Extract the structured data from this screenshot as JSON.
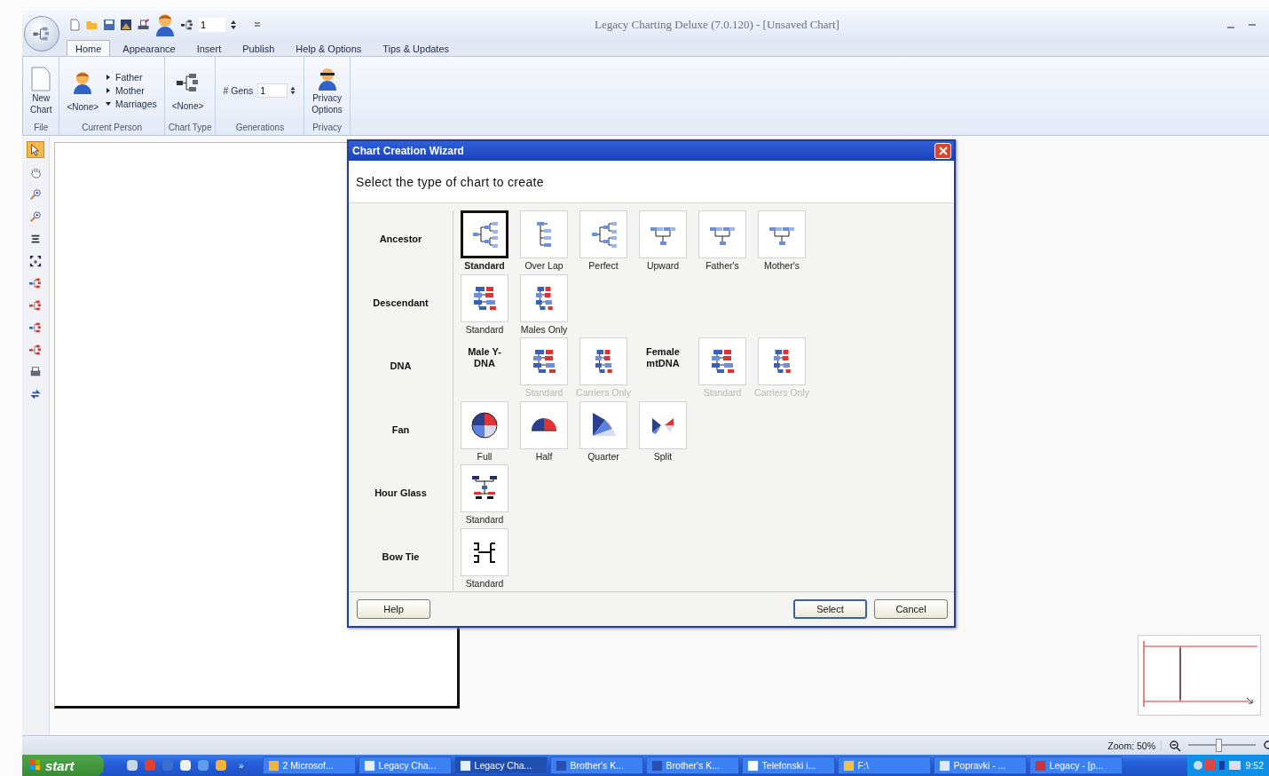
{
  "window": {
    "title": "Legacy Charting Deluxe (7.0.120) - [Unsaved Chart]"
  },
  "quick_access": {
    "value": "1"
  },
  "tabs": [
    {
      "label": "Home",
      "selected": true
    },
    {
      "label": "Appearance",
      "selected": false
    },
    {
      "label": "Insert",
      "selected": false
    },
    {
      "label": "Publish",
      "selected": false
    },
    {
      "label": "Help & Options",
      "selected": false
    },
    {
      "label": "Tips & Updates",
      "selected": false
    }
  ],
  "ribbon": {
    "new_chart": {
      "label": "New Chart",
      "group": "File"
    },
    "current_person": {
      "name": "<None>",
      "group": "Current Person",
      "links": [
        {
          "label": "Father",
          "expanded": false
        },
        {
          "label": "Mother",
          "expanded": false
        },
        {
          "label": "Marriages",
          "expanded": true
        }
      ]
    },
    "chart_type": {
      "label": "<None>",
      "group": "Chart Type"
    },
    "generations": {
      "label": "# Gens",
      "value": "1",
      "group": "Generations"
    },
    "privacy": {
      "label": "Privacy Options",
      "group": "Privacy"
    }
  },
  "tools": [
    {
      "kind": "pointer",
      "selected": true
    },
    {
      "kind": "hand",
      "selected": false
    },
    {
      "kind": "zoom-in",
      "selected": false
    },
    {
      "kind": "zoom-out",
      "selected": false
    },
    {
      "kind": "stack",
      "selected": false
    },
    {
      "kind": "fit",
      "selected": false
    },
    {
      "kind": "tree-blue",
      "selected": false
    },
    {
      "kind": "tree-red",
      "selected": false
    },
    {
      "kind": "tree-blue",
      "selected": false
    },
    {
      "kind": "tree-red",
      "selected": false
    },
    {
      "kind": "printer",
      "selected": false
    },
    {
      "kind": "swap",
      "selected": false
    }
  ],
  "wizard": {
    "title": "Chart Creation Wizard",
    "heading": "Select the type of chart to create",
    "categories": [
      {
        "label": "Ancestor",
        "options": [
          {
            "kind": "ancestor",
            "caption": "Standard",
            "selected": true,
            "disabled": false
          },
          {
            "kind": "overlap",
            "caption": "Over Lap",
            "selected": false,
            "disabled": false
          },
          {
            "kind": "ancestor",
            "caption": "Perfect",
            "selected": false,
            "disabled": false
          },
          {
            "kind": "upward",
            "caption": "Upward",
            "selected": false,
            "disabled": false
          },
          {
            "kind": "upward",
            "caption": "Father's",
            "selected": false,
            "disabled": false
          },
          {
            "kind": "upward",
            "caption": "Mother's",
            "selected": false,
            "disabled": false
          }
        ]
      },
      {
        "label": "Descendant",
        "options": [
          {
            "kind": "descendant",
            "caption": "Standard",
            "selected": false,
            "disabled": false
          },
          {
            "kind": "descendant-narrow",
            "caption": "Males Only",
            "selected": false,
            "disabled": false
          }
        ]
      },
      {
        "label": "DNA",
        "options": [
          {
            "kind": "heading",
            "caption": "Male Y-DNA"
          },
          {
            "kind": "descendant",
            "caption": "Standard",
            "selected": false,
            "disabled": true
          },
          {
            "kind": "descendant-narrow",
            "caption": "Carriers Only",
            "selected": false,
            "disabled": true
          },
          {
            "kind": "heading",
            "caption": "Female mtDNA"
          },
          {
            "kind": "descendant",
            "caption": "Standard",
            "selected": false,
            "disabled": true
          },
          {
            "kind": "descendant-narrow",
            "caption": "Carriers Only",
            "selected": false,
            "disabled": true
          }
        ]
      },
      {
        "label": "Fan",
        "options": [
          {
            "kind": "fan-full",
            "caption": "Full",
            "selected": false,
            "disabled": false
          },
          {
            "kind": "fan-half",
            "caption": "Half",
            "selected": false,
            "disabled": false
          },
          {
            "kind": "fan-quarter",
            "caption": "Quarter",
            "selected": false,
            "disabled": false
          },
          {
            "kind": "fan-split",
            "caption": "Split",
            "selected": false,
            "disabled": false
          }
        ]
      },
      {
        "label": "Hour Glass",
        "options": [
          {
            "kind": "hourglass",
            "caption": "Standard",
            "selected": false,
            "disabled": false
          }
        ]
      },
      {
        "label": "Bow Tie",
        "options": [
          {
            "kind": "bowtie",
            "caption": "Standard",
            "selected": false,
            "disabled": false
          }
        ]
      }
    ],
    "buttons": {
      "help": "Help",
      "select": "Select",
      "cancel": "Cancel"
    }
  },
  "status_bar": {
    "zoom": "Zoom: 50%",
    "zoom_slider": {
      "level": 0.45
    }
  },
  "taskbar": {
    "start": "start",
    "more": "»",
    "tasks": [
      {
        "label": "2 Microsof...",
        "kind": "group",
        "selected": false
      },
      {
        "label": "Legacy Cha...",
        "kind": "chart",
        "selected": false
      },
      {
        "label": "Legacy Cha...",
        "kind": "chart",
        "selected": true
      },
      {
        "label": "Brother's K...",
        "kind": "help",
        "selected": false
      },
      {
        "label": "Brother's K...",
        "kind": "help",
        "selected": false
      },
      {
        "label": "Telefonski i...",
        "kind": "yahoo",
        "selected": false
      },
      {
        "label": "F:\\",
        "kind": "folder",
        "selected": false
      },
      {
        "label": "Popravki - ...",
        "kind": "doc",
        "selected": false
      },
      {
        "label": "Legacy - [p...",
        "kind": "legacy",
        "selected": false
      }
    ],
    "clock": "9:52"
  }
}
